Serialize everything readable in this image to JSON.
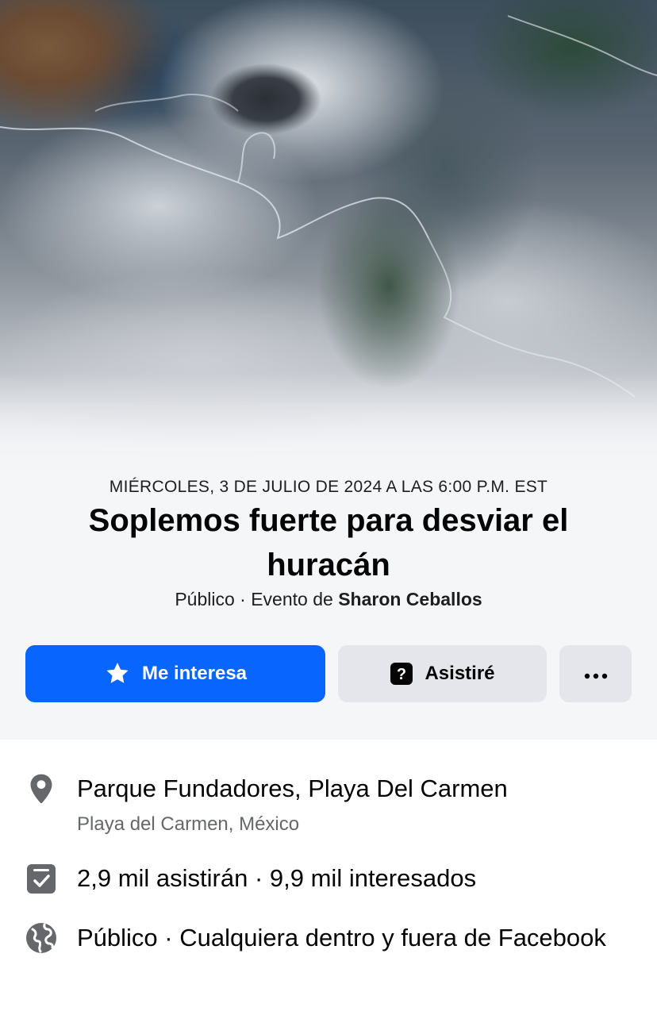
{
  "event": {
    "date_time": "MIÉRCOLES, 3 DE JULIO DE 2024 A LAS 6:00 P.M. EST",
    "title": "Soplemos fuerte para desviar el huracán",
    "privacy": "Público",
    "separator": " · ",
    "host_prefix": "Evento de ",
    "host_name": "Sharon Ceballos"
  },
  "actions": {
    "interested_label": "Me interesa",
    "interested_icon": "star-icon",
    "going_label": "Asistiré",
    "going_icon": "question-icon",
    "more_icon": "more-horizontal-icon"
  },
  "details": {
    "location": {
      "icon": "location-pin-icon",
      "name": "Parque Fundadores, Playa Del Carmen",
      "city": "Playa del Carmen, México"
    },
    "attendance": {
      "icon": "calendar-check-icon",
      "text": "2,9 mil asistirán · 9,9 mil interesados"
    },
    "audience": {
      "icon": "globe-icon",
      "text": "Público · Cualquiera dentro y fuera de Facebook"
    }
  },
  "colors": {
    "primary": "#0866ff",
    "secondary_button": "#e4e6eb",
    "header_background": "#f5f6f8",
    "secondary_text": "#65676b"
  }
}
